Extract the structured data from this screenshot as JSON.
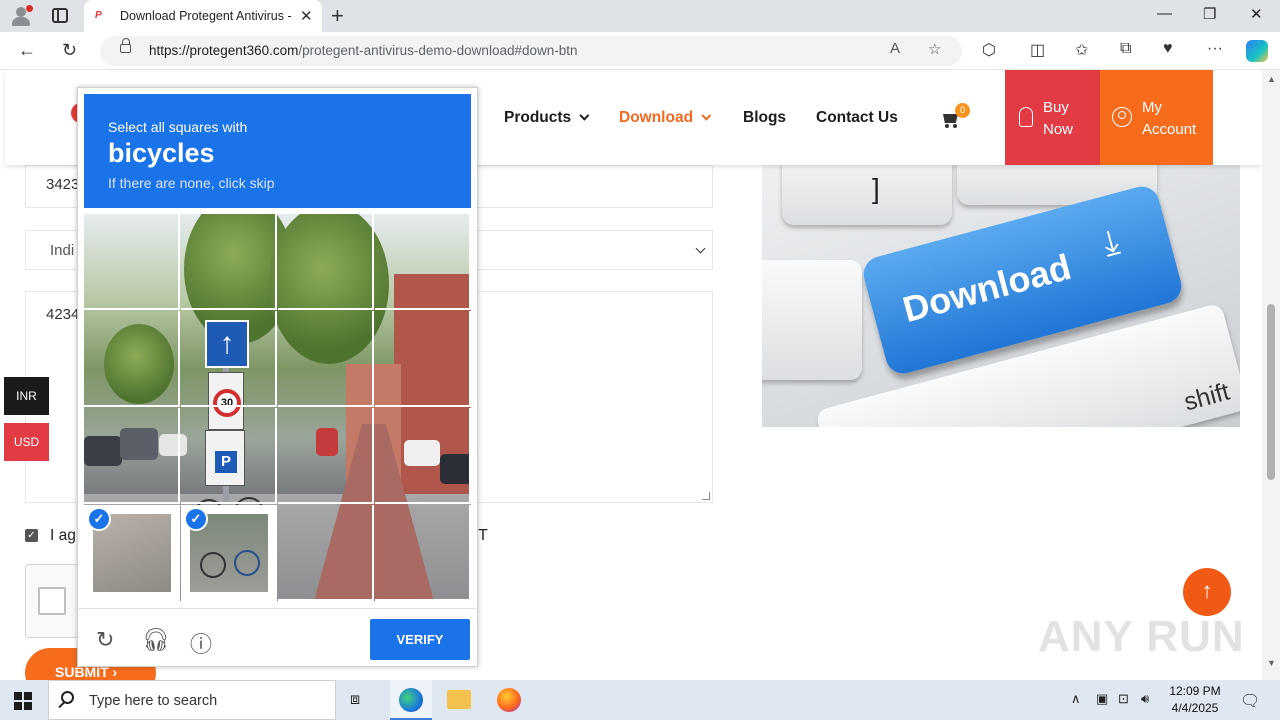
{
  "browser": {
    "tab_title": "Download Protegent Antivirus - Fre",
    "tab_favicon_text": "P",
    "url_domain": "https://protegent360.com",
    "url_path": "/protegent-antivirus-demo-download#down-btn",
    "icons": [
      "profile-icon",
      "tabs-icon",
      "close-icon",
      "new-tab-icon",
      "minimize-icon",
      "maximize-icon",
      "window-close-icon",
      "back-icon",
      "refresh-icon",
      "lock-icon",
      "read-aloud-icon",
      "favorite-icon",
      "extensions-icon",
      "split-screen-icon",
      "favorites-icon",
      "collections-icon",
      "performance-icon",
      "more-icon",
      "copilot-icon"
    ]
  },
  "site": {
    "nav": {
      "products": "Products",
      "download": "Download",
      "blogs": "Blogs",
      "contact": "Contact Us",
      "cart_count": "0"
    },
    "buy_now": [
      "Buy",
      "Now"
    ],
    "my_account": [
      "My",
      "Account"
    ],
    "form": {
      "phone_partial": "3423",
      "country_partial": "Indi",
      "message_partial": "4234",
      "agree_partial": "I ag",
      "agree_tail": "NT",
      "submit": "SUBMIT"
    },
    "currency": {
      "inr": "INR",
      "usd": "USD"
    },
    "banner": {
      "key_label": "Download",
      "shift_label": "shift",
      "bracket": "]"
    },
    "watermark": "ANY RUN",
    "accent_orange": "#f66c1c",
    "accent_red": "#e23b44"
  },
  "captcha": {
    "line1": "Select all squares with",
    "keyword": "bicycles",
    "line3": "If there are none, click skip",
    "verify": "VERIFY",
    "tiles_selected": [
      12,
      13
    ],
    "header_color": "#1a73e8"
  },
  "taskbar": {
    "search_placeholder": "Type here to search",
    "time": "12:09 PM",
    "date": "4/4/2025"
  }
}
